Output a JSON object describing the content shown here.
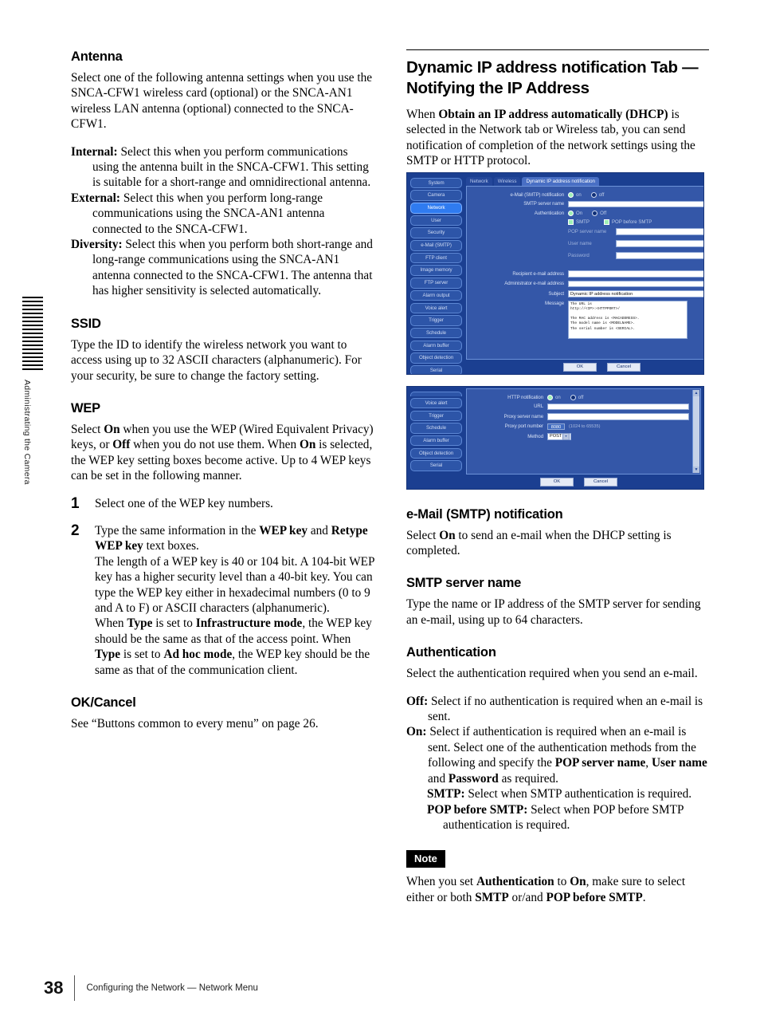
{
  "side_tab": {
    "label": "Administrating the Camera"
  },
  "footer": {
    "page_number": "38",
    "running_head": "Configuring the Network — Network Menu"
  },
  "left_column": {
    "antenna": {
      "heading": "Antenna",
      "intro": "Select one of the following antenna settings when you use the SNCA-CFW1 wireless card (optional) or the SNCA-AN1 wireless LAN antenna (optional) connected to the SNCA-CFW1.",
      "items": [
        {
          "term": "Internal:",
          "text": " Select this when you perform communications using the antenna built in the SNCA-CFW1. This setting is suitable for a short-range and omnidirectional antenna."
        },
        {
          "term": "External:",
          "text": " Select this when you perform long-range communications using the SNCA-AN1 antenna connected to the SNCA-CFW1."
        },
        {
          "term": "Diversity:",
          "text": " Select this when you perform both short-range and long-range communications using the SNCA-AN1 antenna connected to the SNCA-CFW1. The antenna that has higher sensitivity is selected automatically."
        }
      ]
    },
    "ssid": {
      "heading": "SSID",
      "body": "Type the ID to identify the wireless network you want to access using up to 32 ASCII characters (alphanumeric). For your security, be sure to change the factory setting."
    },
    "wep": {
      "heading": "WEP",
      "body_1": "Select ",
      "body_1_b1": "On",
      "body_2": " when you use the WEP (Wired Equivalent Privacy) keys, or ",
      "body_2_b": "Off",
      "body_3": " when you do not use them. When ",
      "body_3_b": "On",
      "body_4": " is selected, the WEP key setting boxes become active. Up to 4 WEP keys can be set in the following manner.",
      "steps": [
        {
          "num": "1",
          "text": "Select one of the WEP key numbers."
        },
        {
          "num": "2",
          "p1_pre": "Type the same information in the ",
          "p1_b1": "WEP key",
          "p1_mid": " and ",
          "p1_b2": "Retype WEP key",
          "p1_post": " text boxes.",
          "p2": "The length of a WEP key is 40 or 104 bit. A 104-bit WEP key has a higher security level than a 40-bit key. You can type the WEP key either in hexadecimal numbers (0 to 9 and A to F) or ASCII characters (alphanumeric).",
          "p3_pre": "When ",
          "p3_b1": "Type",
          "p3_mid1": " is set to ",
          "p3_b2": "Infrastructure mode",
          "p3_mid2": ", the WEP key should be the same as that of the access point. When ",
          "p3_b3": "Type",
          "p3_mid3": " is set to ",
          "p3_b4": "Ad hoc mode",
          "p3_post": ", the WEP key should be the same as that of the communication client."
        }
      ]
    },
    "ok_cancel": {
      "heading": "OK/Cancel",
      "body": "See “Buttons common to every menu” on page 26."
    }
  },
  "right_column": {
    "chapter_title": "Dynamic IP address notification Tab — Notifying the IP Address",
    "intro_pre": "When ",
    "intro_bold": "Obtain an IP address automatically (DHCP)",
    "intro_post": " is selected in the Network tab or Wireless tab, you can send notification of completion of the network settings using the SMTP or HTTP protocol.",
    "email_smtp": {
      "heading": "e-Mail (SMTP) notification",
      "body_pre": "Select ",
      "body_bold": "On",
      "body_post": " to send an e-mail when the DHCP setting is completed."
    },
    "smtp_server": {
      "heading": "SMTP server name",
      "body": "Type the name or IP address of the SMTP server for sending an e-mail, using up to 64 characters."
    },
    "authentication": {
      "heading": "Authentication",
      "body": "Select the authentication required when you send an e-mail.",
      "off": {
        "term": "Off:",
        "text": " Select if no authentication is required when an e-mail is sent."
      },
      "on": {
        "term": "On:",
        "t1": " Select if authentication is required when an e-mail is sent. Select one of the authentication methods from the following and specify the ",
        "b1": "POP server name",
        "t2": ", ",
        "b2": "User name",
        "t3": " and ",
        "b3": "Password",
        "t4": " as required."
      },
      "smtp_sub": {
        "term": "SMTP:",
        "text": " Select when SMTP authentication is required."
      },
      "pop_sub": {
        "term": "POP before SMTP:",
        "text": " Select when POP before SMTP authentication is required."
      }
    },
    "note": {
      "badge": "Note",
      "t1": "When you set ",
      "b1": "Authentication",
      "t2": " to ",
      "b2": "On",
      "t3": ", make sure to select either or both ",
      "b3": "SMTP",
      "t4": " or/and ",
      "b4": "POP before SMTP",
      "t5": "."
    }
  },
  "screenshot_smtp": {
    "sidebar": [
      {
        "label": "System",
        "active": false
      },
      {
        "label": "Camera",
        "active": false
      },
      {
        "label": "Network",
        "active": true
      },
      {
        "label": "User",
        "active": false
      },
      {
        "label": "Security",
        "active": false
      },
      {
        "label": "e-Mail (SMTP)",
        "active": false
      },
      {
        "label": "FTP client",
        "active": false
      },
      {
        "label": "Image memory",
        "active": false
      },
      {
        "label": "FTP server",
        "active": false
      },
      {
        "label": "Alarm output",
        "active": false
      },
      {
        "label": "Voice alert",
        "active": false
      },
      {
        "label": "Trigger",
        "active": false
      },
      {
        "label": "Schedule",
        "active": false
      },
      {
        "label": "Alarm buffer",
        "active": false
      },
      {
        "label": "Object detection",
        "active": false
      },
      {
        "label": "Serial",
        "active": false
      }
    ],
    "tabs": [
      {
        "label": "Network",
        "active": false
      },
      {
        "label": "Wireless",
        "active": false
      },
      {
        "label": "Dynamic IP address notification",
        "active": true
      }
    ],
    "notification_label": "e-Mail (SMTP) notification",
    "notification_on": "on",
    "notification_off": "off",
    "smtp_server_label": "SMTP server name",
    "smtp_server_value": "",
    "auth_label": "Authentication",
    "auth_on": "On",
    "auth_off": "Off",
    "chk_smtp": "SMTP",
    "chk_pop_before_smtp": "POP before SMTP",
    "pop_server_label": "POP server name",
    "pop_server_value": "",
    "user_name_label": "User name",
    "user_name_value": "",
    "password_label": "Password",
    "password_value": "",
    "recipient_label": "Recipient e-mail address",
    "recipient_value": "",
    "administrator_label": "Administrator e-mail address",
    "administrator_value": "",
    "subject_label": "Subject",
    "subject_value": "Dynamic IP address notification",
    "message_label": "Message",
    "message_value": "The URL is\nhttp://<IP>:<HTTPPORT>/\n\nThe MAC address is <MACADDRESS>.\nThe model name is <MODELNAME>.\nThe serial number is <SERIAL>.",
    "ok_label": "OK",
    "cancel_label": "Cancel"
  },
  "screenshot_http": {
    "sidebar": [
      {
        "label": "Voice alert",
        "active": false
      },
      {
        "label": "Trigger",
        "active": false
      },
      {
        "label": "Schedule",
        "active": false
      },
      {
        "label": "Alarm buffer",
        "active": false
      },
      {
        "label": "Object detection",
        "active": false
      },
      {
        "label": "Serial",
        "active": false
      }
    ],
    "notification_label": "HTTP notification",
    "notification_on": "on",
    "notification_off": "off",
    "url_label": "URL",
    "url_value": "",
    "proxy_server_label": "Proxy server name",
    "proxy_server_value": "",
    "proxy_port_label": "Proxy port number",
    "proxy_port_value": "8080",
    "proxy_port_hint": "(1024 to 65535)",
    "method_label": "Method",
    "method_value": "POST",
    "ok_label": "OK",
    "cancel_label": "Cancel"
  }
}
